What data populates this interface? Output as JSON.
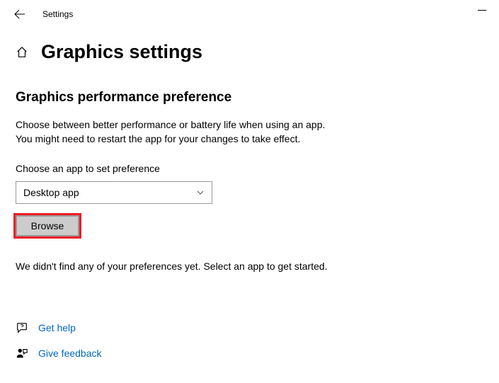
{
  "titlebar": {
    "title": "Settings"
  },
  "page": {
    "title": "Graphics settings"
  },
  "section": {
    "heading": "Graphics performance preference",
    "description_line1": "Choose between better performance or battery life when using an app.",
    "description_line2": "You might need to restart the app for your changes to take effect.",
    "select_label": "Choose an app to set preference",
    "select_value": "Desktop app",
    "browse_label": "Browse",
    "empty_message": "We didn't find any of your preferences yet. Select an app to get started."
  },
  "help": {
    "get_help": "Get help",
    "give_feedback": "Give feedback"
  }
}
